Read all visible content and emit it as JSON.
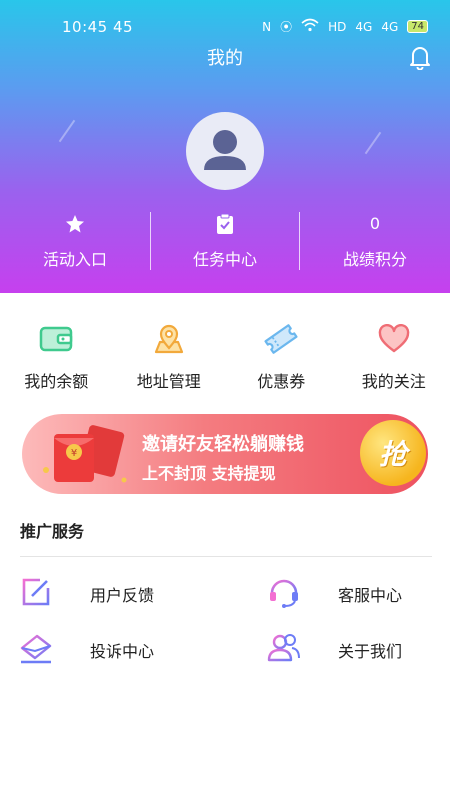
{
  "status_bar": {
    "time": "10:45 45",
    "indicators": [
      "N",
      "⦿",
      "WiFi",
      "HD",
      "4G",
      "4G"
    ],
    "battery": "74"
  },
  "header": {
    "title": "我的"
  },
  "stats": [
    {
      "icon": "star-icon",
      "label": "活动入口"
    },
    {
      "icon": "task-clipboard-icon",
      "label": "任务中心"
    },
    {
      "value": "0",
      "label": "战绩积分"
    }
  ],
  "quick_actions": [
    {
      "icon": "wallet-icon",
      "label": "我的余额"
    },
    {
      "icon": "location-pin-icon",
      "label": "地址管理"
    },
    {
      "icon": "coupon-ticket-icon",
      "label": "优惠券"
    },
    {
      "icon": "heart-icon",
      "label": "我的关注"
    }
  ],
  "banner": {
    "line1": "邀请好友轻松躺赚钱",
    "line2": "上不封顶  支持提现",
    "button": "抢"
  },
  "section": {
    "title": "推广服务"
  },
  "services": [
    {
      "icon": "feedback-edit-icon",
      "label": "用户反馈"
    },
    {
      "icon": "headset-icon",
      "label": "客服中心"
    },
    {
      "icon": "complaint-envelope-icon",
      "label": "投诉中心"
    },
    {
      "icon": "users-group-icon",
      "label": "关于我们"
    }
  ],
  "colors": {
    "gradient_top": "#29c6ea",
    "gradient_bottom": "#c640ee",
    "banner_red": "#ee5260",
    "accent_gold": "#f6b51e"
  }
}
